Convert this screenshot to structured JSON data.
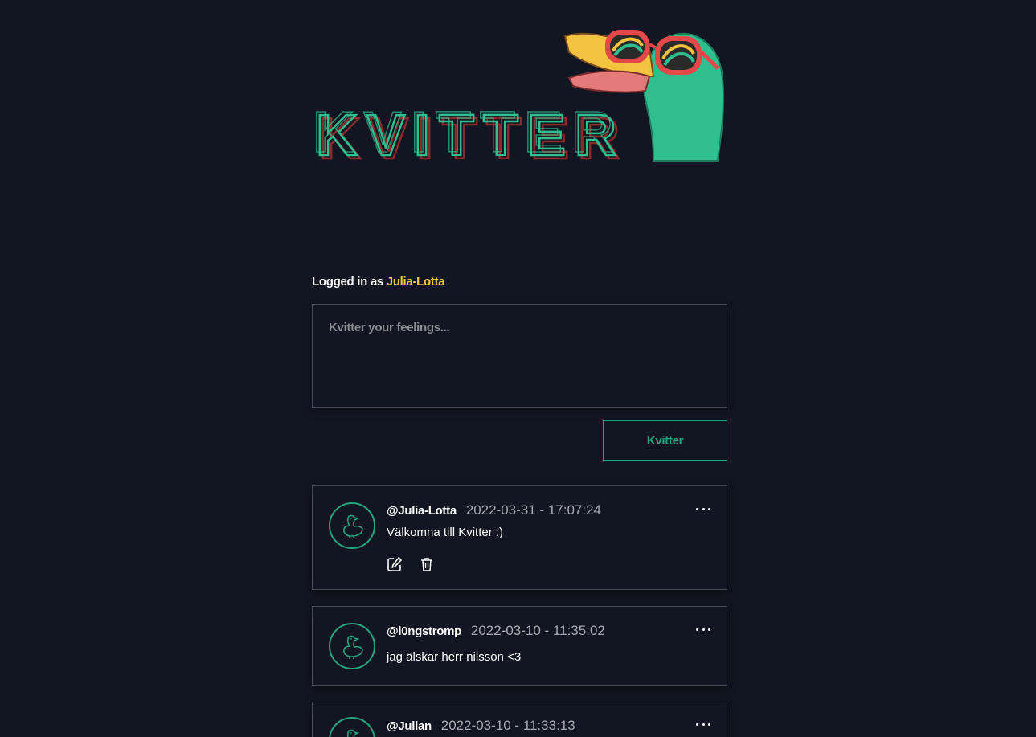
{
  "brand": {
    "logo_text": "KVITTER",
    "accent": "#27a37e",
    "shadow": "#8a2b2b",
    "user_color": "#f5c842"
  },
  "session": {
    "prefix": "Logged in as",
    "username": "Julia-Lotta"
  },
  "compose": {
    "placeholder": "Kvitter your feelings...",
    "submit_label": "Kvitter"
  },
  "posts": [
    {
      "author": "@Julia-Lotta",
      "timestamp": "2022-03-31 - 17:07:24",
      "text": "Välkomna till Kvitter :)",
      "own": true,
      "icons": [
        "edit-icon",
        "trash-icon"
      ]
    },
    {
      "author": "@l0ngstromp",
      "timestamp": "2022-03-10 - 11:35:02",
      "text": "jag älskar herr nilsson <3",
      "own": false
    },
    {
      "author": "@Jullan",
      "timestamp": "2022-03-10 - 11:33:13",
      "text": "",
      "own": false
    }
  ]
}
